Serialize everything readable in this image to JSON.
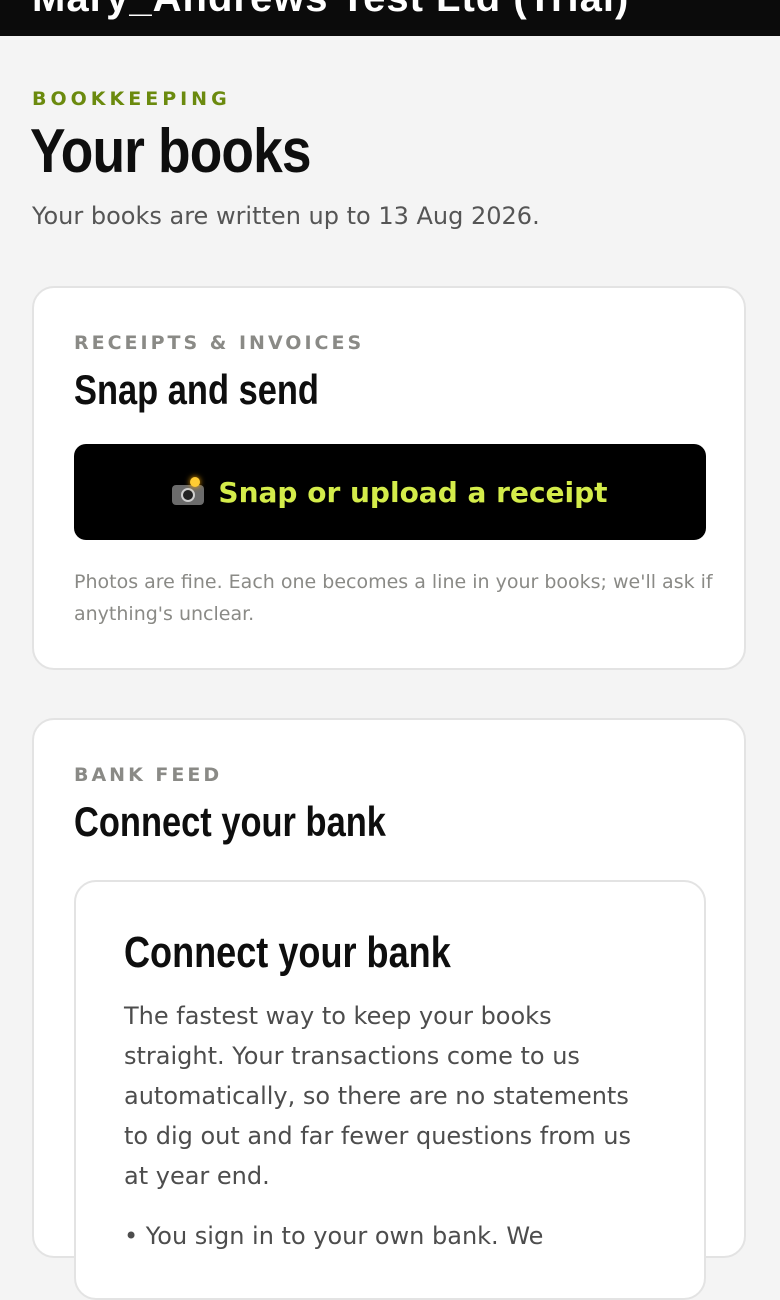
{
  "header": {
    "title": "Mary_Andrews Test Ltd (Trial)"
  },
  "page": {
    "eyebrow": "BOOKKEEPING",
    "title": "Your books",
    "subtitle": "Your books are written up to 13 Aug 2026."
  },
  "receipts_card": {
    "kicker": "RECEIPTS & INVOICES",
    "heading": "Snap and send",
    "button_icon": "camera-with-flash-icon",
    "button_label": "Snap or upload a receipt",
    "note": "Photos are fine. Each one becomes a line in your books; we'll ask if anything's unclear."
  },
  "bank_card": {
    "kicker": "BANK FEED",
    "heading": "Connect your bank",
    "inner": {
      "heading": "Connect your bank",
      "body": "The fastest way to keep your books straight. Your transactions come to us automatically, so there are no statements to dig out and far fewer questions from us at year end.",
      "next_line": "• You sign in to your own bank. We"
    }
  },
  "colors": {
    "accent": "#6b8a0e",
    "button_text": "#d4ec4a",
    "button_bg": "#000000",
    "topbar_bg": "#0b0b0b",
    "page_bg": "#f4f4f4"
  }
}
